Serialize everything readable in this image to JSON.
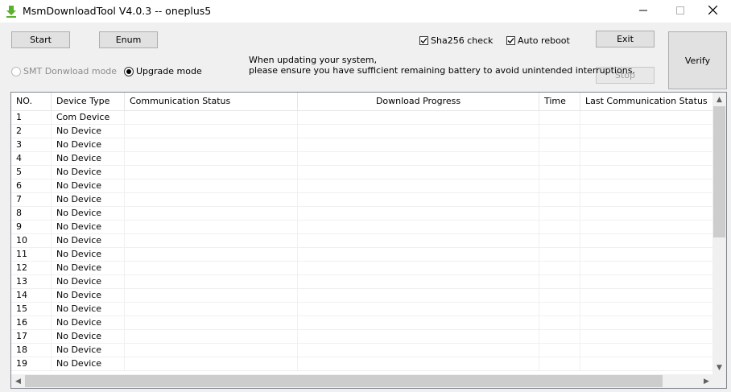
{
  "window": {
    "title": "MsmDownloadTool V4.0.3 -- oneplus5",
    "app_icon": "download-arrow-icon",
    "minimize_icon": "minimize-icon",
    "maximize_icon": "maximize-icon",
    "close_icon": "close-icon"
  },
  "toolbar": {
    "start_label": "Start",
    "enum_label": "Enum",
    "sha256_label": "Sha256 check",
    "sha256_checked": true,
    "auto_reboot_label": "Auto reboot",
    "auto_reboot_checked": true,
    "exit_label": "Exit",
    "stop_label": "Stop",
    "verify_label": "Verify",
    "smt_mode_label": "SMT Donwload mode",
    "upgrade_mode_label": "Upgrade mode",
    "selected_mode": "upgrade",
    "notice_line1": "When updating your system,",
    "notice_line2": "please ensure you have sufficient remaining battery to avoid unintended interruptions."
  },
  "table": {
    "columns": [
      "NO.",
      "Device Type",
      "Communication Status",
      "Download Progress",
      "Time",
      "Last Communication Status"
    ],
    "rows": [
      {
        "no": "1",
        "device_type": "Com Device"
      },
      {
        "no": "2",
        "device_type": "No Device"
      },
      {
        "no": "3",
        "device_type": "No Device"
      },
      {
        "no": "4",
        "device_type": "No Device"
      },
      {
        "no": "5",
        "device_type": "No Device"
      },
      {
        "no": "6",
        "device_type": "No Device"
      },
      {
        "no": "7",
        "device_type": "No Device"
      },
      {
        "no": "8",
        "device_type": "No Device"
      },
      {
        "no": "9",
        "device_type": "No Device"
      },
      {
        "no": "10",
        "device_type": "No Device"
      },
      {
        "no": "11",
        "device_type": "No Device"
      },
      {
        "no": "12",
        "device_type": "No Device"
      },
      {
        "no": "13",
        "device_type": "No Device"
      },
      {
        "no": "14",
        "device_type": "No Device"
      },
      {
        "no": "15",
        "device_type": "No Device"
      },
      {
        "no": "16",
        "device_type": "No Device"
      },
      {
        "no": "17",
        "device_type": "No Device"
      },
      {
        "no": "18",
        "device_type": "No Device"
      },
      {
        "no": "19",
        "device_type": "No Device"
      }
    ]
  }
}
